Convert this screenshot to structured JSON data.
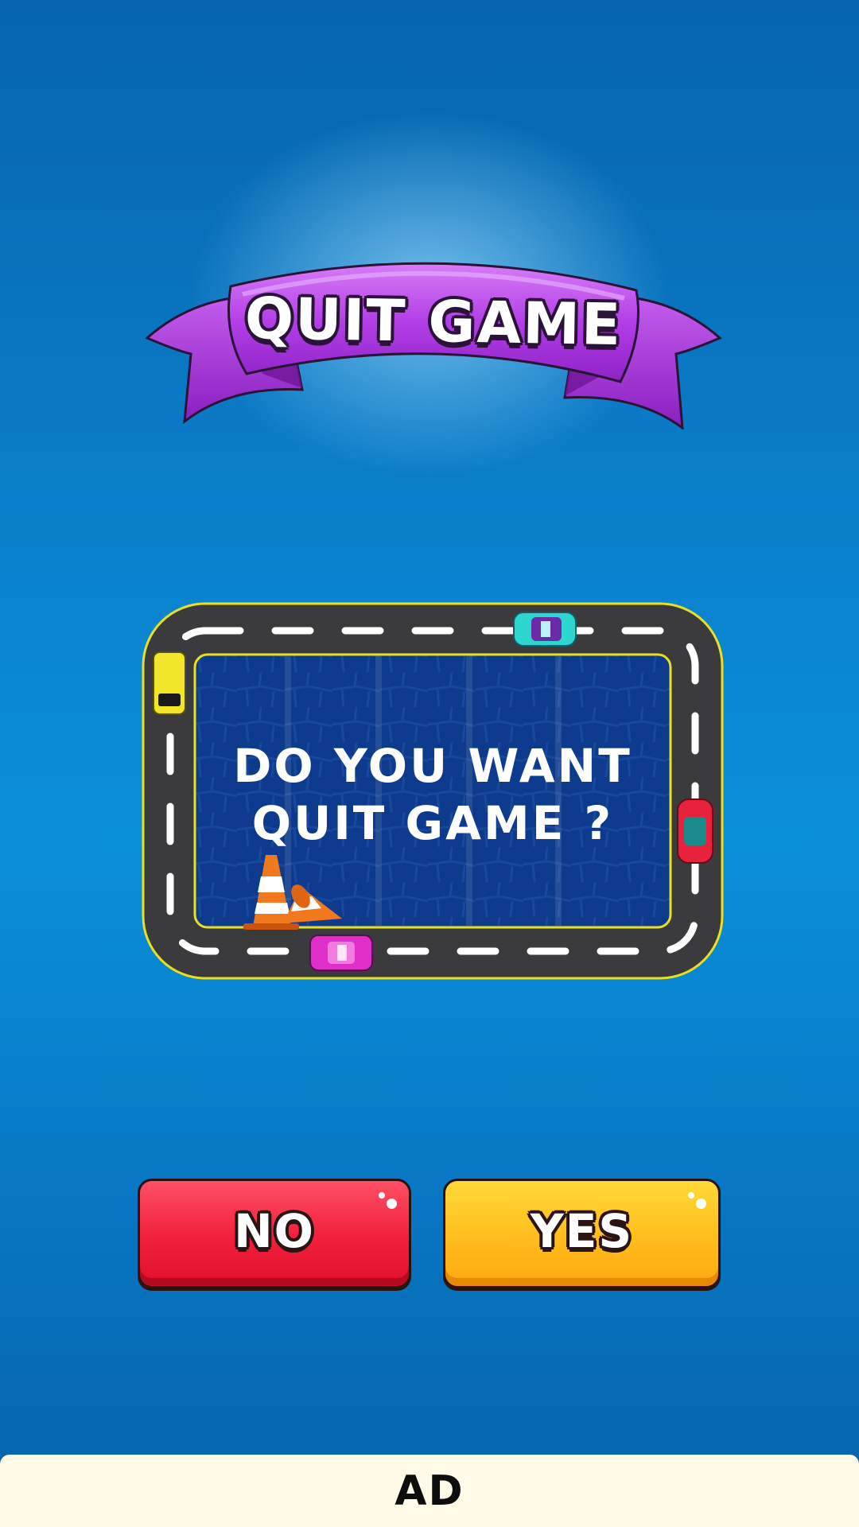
{
  "title_banner": {
    "text": "QUIT GAME",
    "color": "#b23ee6"
  },
  "dialog": {
    "line1": "DO YOU WANT",
    "line2": "QUIT GAME ?"
  },
  "buttons": {
    "no": {
      "label": "NO",
      "color": "#f11f3c"
    },
    "yes": {
      "label": "YES",
      "color": "#ffbd1a"
    }
  },
  "ad": {
    "label": "AD"
  },
  "icons": [
    "ribbon-banner",
    "race-track",
    "traffic-cone-icon",
    "car-icon"
  ],
  "colors": {
    "background": "#0a90d8",
    "track_border": "#e8e020",
    "board_fill": "#0d3a8c"
  }
}
